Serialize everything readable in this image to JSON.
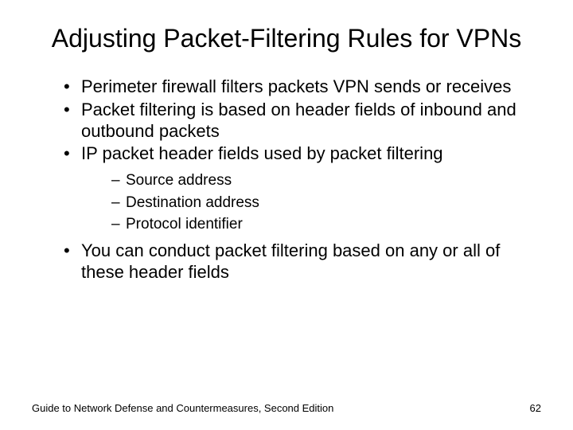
{
  "title": "Adjusting Packet-Filtering Rules for VPNs",
  "bullets": {
    "b0": "Perimeter firewall filters packets VPN sends or receives",
    "b1": "Packet filtering is based on header fields of inbound and outbound packets",
    "b2": "IP packet header fields used by packet filtering",
    "b3": "You can conduct packet filtering based on any or all of these header fields"
  },
  "sub": {
    "s0": "Source address",
    "s1": "Destination address",
    "s2": "Protocol identifier"
  },
  "footer": {
    "left": "Guide to Network Defense and Countermeasures, Second Edition",
    "right": "62"
  }
}
